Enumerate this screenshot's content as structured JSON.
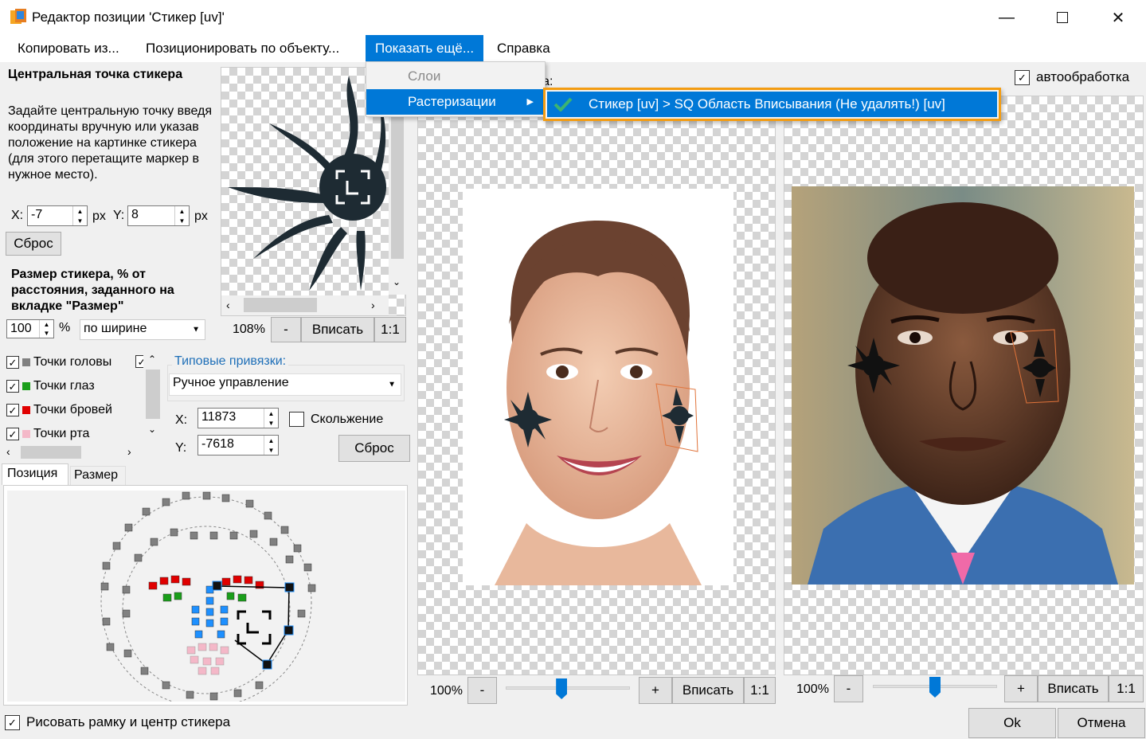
{
  "window": {
    "title": "Редактор позиции 'Стикер [uv]'"
  },
  "menu": {
    "items": [
      "Копировать из...",
      "Позиционировать по объекту...",
      "Показать ещё...",
      "Справка"
    ],
    "dropdown": {
      "layers": "Слои",
      "rasterizations": "Растеризации",
      "submenu_item": "Стикер [uv] > SQ Область Вписывания (Не удалять!) [uv]"
    }
  },
  "left": {
    "center_title": "Центральная точка стикера",
    "center_desc": "Задайте центральную точку введя координаты вручную или указав положение на картинке стикера (для этого перетащите маркер в нужное место).",
    "x_label": "X:",
    "x_value": "-7",
    "y_label": "Y:",
    "y_value": "8",
    "px": "px",
    "reset": "Сброс",
    "size_title": "Размер стикера, % от расстояния, заданного на вкладке \"Размер\"",
    "size_value": "100",
    "percent": "%",
    "size_mode": "по ширине",
    "zoom": "108%",
    "minus": "-",
    "fit": "Вписать",
    "one_to_one": "1:1"
  },
  "points": {
    "items": [
      {
        "label": "Точки головы",
        "color": "#808080"
      },
      {
        "label": "Точки глаз",
        "color": "#1a9e1a"
      },
      {
        "label": "Точки бровей",
        "color": "#e00000"
      },
      {
        "label": "Точки рта",
        "color": "#f4b8c8"
      }
    ]
  },
  "snap": {
    "title": "Типовые привязки:",
    "mode": "Ручное управление",
    "x_label": "X:",
    "x_value": "11873",
    "y_label": "Y:",
    "y_value": "-7618",
    "sliding": "Скольжение",
    "reset": "Сброс"
  },
  "tabs": [
    "Позиция",
    "Размер"
  ],
  "preview": {
    "partial_label": "та:",
    "autoprocess": "автообработка"
  },
  "views": {
    "left": {
      "zoom": "100%",
      "minus": "-",
      "plus": "+",
      "fit": "Вписать",
      "one_to_one": "1:1",
      "slider_pct": 45
    },
    "right": {
      "zoom": "100%",
      "minus": "-",
      "plus": "+",
      "fit": "Вписать",
      "one_to_one": "1:1",
      "slider_pct": 50
    }
  },
  "footer": {
    "draw_frame": "Рисовать рамку и центр стикера",
    "ok": "Ok",
    "cancel": "Отмена"
  },
  "colors": {
    "accent": "#0078d7",
    "highlight": "#f39c12",
    "checked": "#3cb371"
  }
}
